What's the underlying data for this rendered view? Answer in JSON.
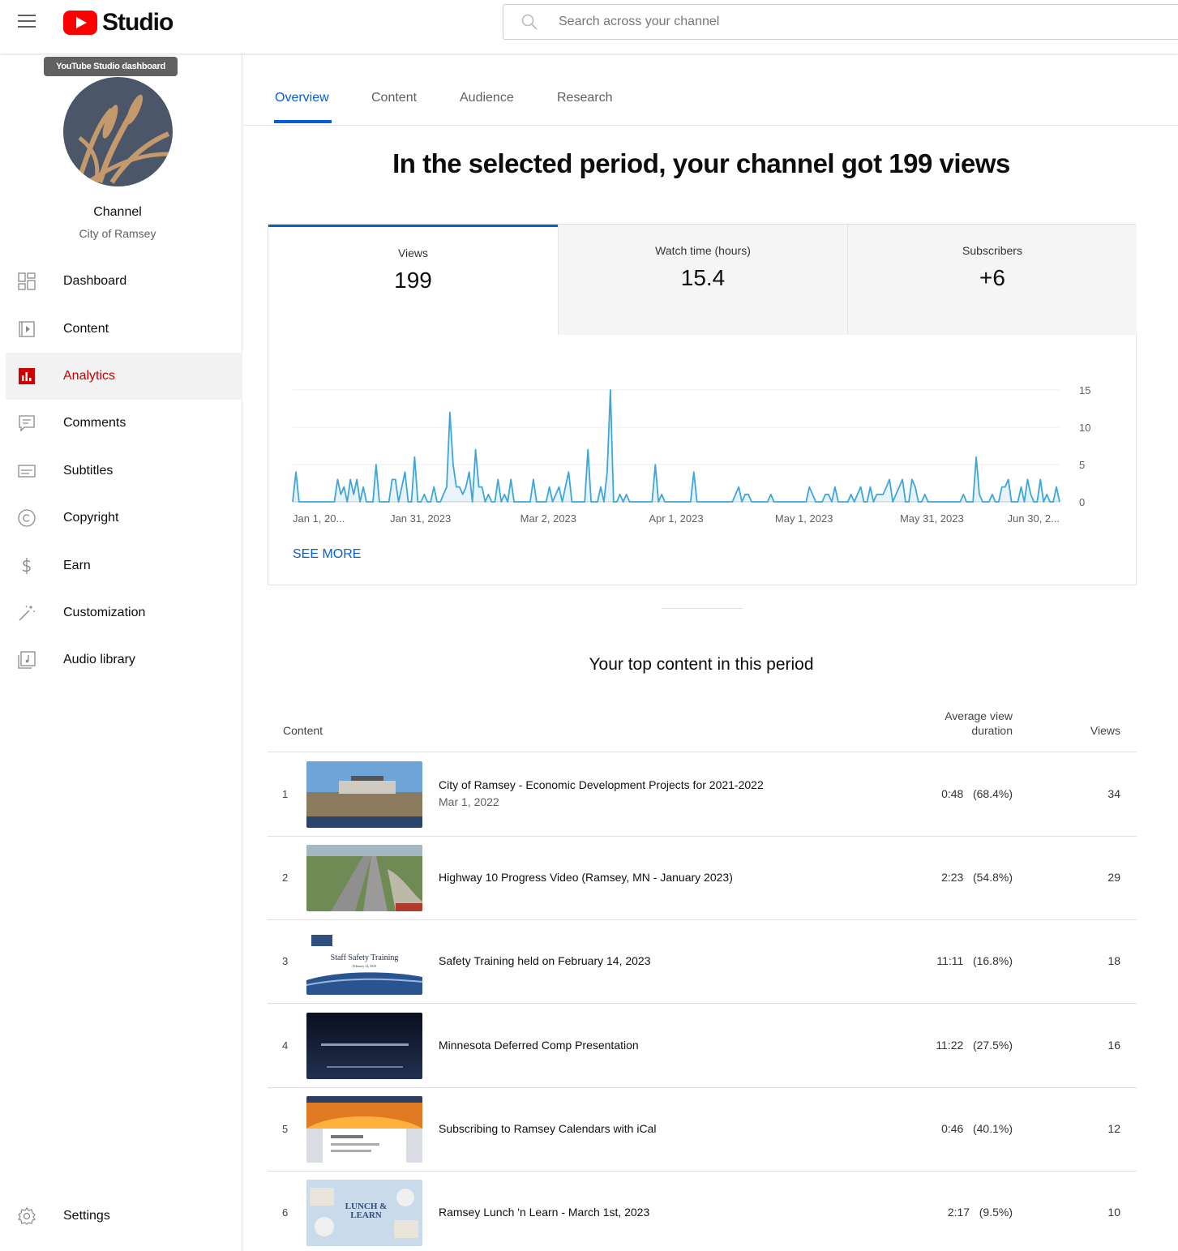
{
  "app": {
    "title": "Studio"
  },
  "search": {
    "placeholder": "Search across your channel"
  },
  "sidebar": {
    "tooltip": "YouTube Studio dashboard",
    "channel_title": "Channel",
    "channel_name": "City of Ramsey",
    "items": [
      {
        "label": "Dashboard",
        "icon": "dashboard-icon"
      },
      {
        "label": "Content",
        "icon": "content-icon"
      },
      {
        "label": "Analytics",
        "icon": "analytics-icon",
        "active": true
      },
      {
        "label": "Comments",
        "icon": "comments-icon"
      },
      {
        "label": "Subtitles",
        "icon": "subtitles-icon"
      },
      {
        "label": "Copyright",
        "icon": "copyright-icon"
      },
      {
        "label": "Earn",
        "icon": "earn-icon"
      },
      {
        "label": "Customization",
        "icon": "customization-icon"
      },
      {
        "label": "Audio library",
        "icon": "audio-library-icon"
      }
    ],
    "settings_label": "Settings"
  },
  "tabs": [
    {
      "label": "Overview",
      "active": true
    },
    {
      "label": "Content"
    },
    {
      "label": "Audience"
    },
    {
      "label": "Research"
    }
  ],
  "headline": "In the selected period, your channel got 199 views",
  "metrics": [
    {
      "label": "Views",
      "value": "199",
      "active": true
    },
    {
      "label": "Watch time (hours)",
      "value": "15.4"
    },
    {
      "label": "Subscribers",
      "value": "+6"
    }
  ],
  "see_more": "SEE MORE",
  "colors": {
    "accent": "#065fd4",
    "brand_red": "#ff0000",
    "chart_line": "#3ea6d9",
    "active_nav": "#cc0000"
  },
  "chart_data": {
    "type": "line",
    "x_tick_labels": [
      "Jan 1, 20...",
      "Jan 31, 2023",
      "Mar 2, 2023",
      "Apr 1, 2023",
      "May 1, 2023",
      "May 31, 2023",
      "Jun 30, 2..."
    ],
    "y_ticks": [
      0,
      5,
      10,
      15
    ],
    "ylim": [
      0,
      15
    ],
    "grid": true,
    "series": [
      {
        "values": [
          0,
          4,
          0,
          0,
          0,
          0,
          0,
          0,
          0,
          0,
          0,
          0,
          0,
          0,
          3,
          1,
          2,
          0,
          3,
          1,
          3,
          0,
          2,
          0,
          0,
          0,
          5,
          0,
          0,
          0,
          0,
          3,
          3,
          0,
          2,
          4,
          0,
          0,
          6,
          0,
          0,
          1,
          0,
          0,
          2,
          0,
          0,
          1,
          2,
          12,
          5,
          2,
          2,
          1,
          2,
          4,
          0,
          7,
          2,
          2,
          0,
          1,
          0,
          0,
          3,
          0,
          1,
          0,
          3,
          0,
          0,
          0,
          0,
          0,
          0,
          3,
          0,
          0,
          0,
          0,
          2,
          0,
          1,
          2,
          0,
          2,
          4,
          0,
          0,
          0,
          0,
          0,
          7,
          0,
          0,
          0,
          2,
          0,
          4,
          15,
          0,
          0,
          1,
          0,
          1,
          0,
          0,
          0,
          0,
          0,
          0,
          0,
          0,
          5,
          0,
          1,
          0,
          0,
          0,
          0,
          0,
          0,
          0,
          0,
          0,
          4,
          0,
          0,
          0,
          0,
          0,
          0,
          0,
          0,
          0,
          0,
          0,
          0,
          1,
          2,
          0,
          1,
          1,
          0,
          0,
          0,
          0,
          0,
          0,
          1,
          0,
          0,
          0,
          0,
          0,
          0,
          0,
          0,
          0,
          0,
          0,
          2,
          1,
          0,
          0,
          0,
          1,
          1,
          0,
          2,
          0,
          0,
          0,
          0,
          1,
          0,
          1,
          2,
          0,
          0,
          2,
          0,
          1,
          1,
          1,
          2,
          3,
          0,
          1,
          2,
          3,
          0,
          0,
          3,
          2,
          0,
          0,
          1,
          0,
          0,
          0,
          0,
          0,
          0,
          0,
          0,
          0,
          0,
          0,
          1,
          0,
          0,
          0,
          6,
          1,
          0,
          0,
          0,
          1,
          0,
          0,
          2,
          2,
          3,
          0,
          0,
          0,
          2,
          0,
          3,
          1,
          0,
          0,
          3,
          0,
          1,
          0,
          0,
          2,
          0
        ]
      }
    ]
  },
  "top_content": {
    "title": "Your top content in this period",
    "headers": {
      "content": "Content",
      "avd_line1": "Average view",
      "avd_line2": "duration",
      "views": "Views"
    },
    "rows": [
      {
        "rank": "1",
        "title": "City of Ramsey - Economic Development Projects for 2021-2022",
        "date": "Mar 1, 2022",
        "avd": "0:48   (68.4%)",
        "views": "34"
      },
      {
        "rank": "2",
        "title": "Highway 10 Progress Video (Ramsey, MN - January 2023)",
        "date": "",
        "avd": "2:23   (54.8%)",
        "views": "29"
      },
      {
        "rank": "3",
        "title": "Safety Training held on February 14, 2023",
        "date": "",
        "avd": "11:11   (16.8%)",
        "views": "18",
        "thumb_text": "Staff Safety Training",
        "thumb_subtext": "February 14, 2023"
      },
      {
        "rank": "4",
        "title": "Minnesota Deferred Comp Presentation",
        "date": "",
        "avd": "11:22   (27.5%)",
        "views": "16"
      },
      {
        "rank": "5",
        "title": "Subscribing to Ramsey Calendars with iCal",
        "date": "",
        "avd": "0:46   (40.1%)",
        "views": "12"
      },
      {
        "rank": "6",
        "title": "Ramsey Lunch 'n Learn - March 1st, 2023",
        "date": "",
        "avd": "2:17   (9.5%)",
        "views": "10",
        "thumb_text": "LUNCH & LEARN"
      }
    ]
  }
}
